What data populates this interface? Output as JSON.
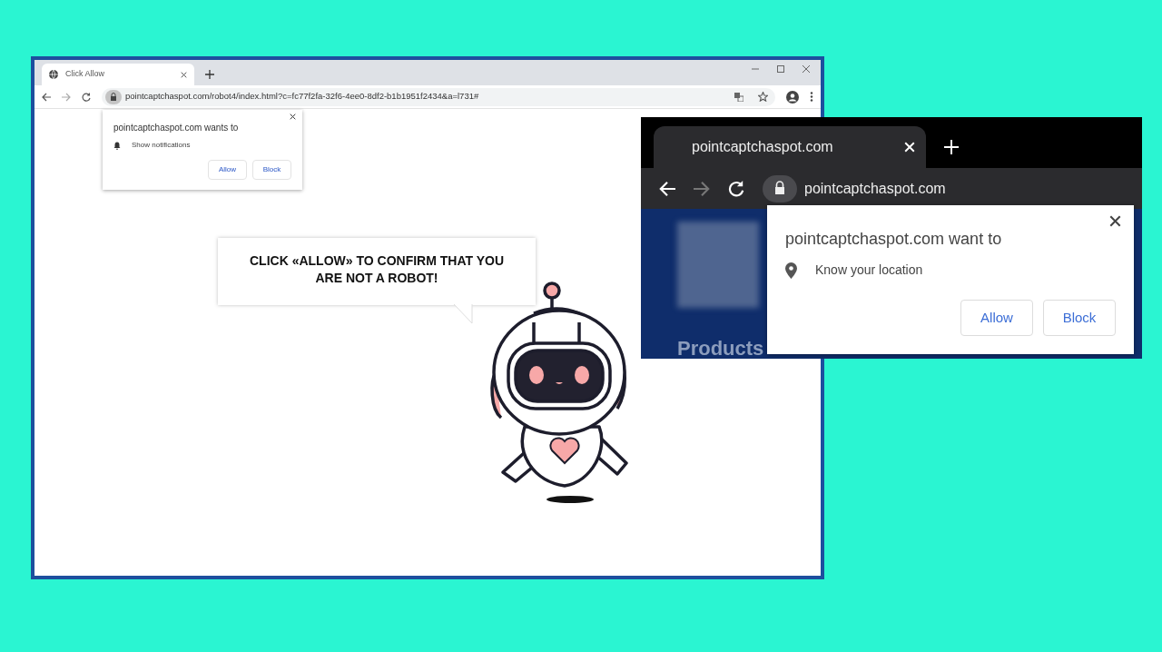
{
  "notification_window": {
    "tab": {
      "title": "Click Allow",
      "selected": true
    },
    "address": "pointcaptchaspot.com/robot4/index.html?c=fc77f2fa-32f6-4ee0-8df2-b1b1951f2434&a=l731#",
    "prompt": {
      "title": "pointcaptchaspot.com wants to",
      "permission": "Show notifications",
      "buttons": [
        "Allow",
        "Block"
      ]
    },
    "page": {
      "headline": "CLICK «ALLOW» TO CONFIRM THAT YOU ARE NOT A ROBOT!"
    }
  },
  "location_window": {
    "tab": {
      "title": "pointcaptchaspot.com",
      "selected": true
    },
    "address": "pointcaptchaspot.com",
    "prompt": {
      "title": "pointcaptchaspot.com want to",
      "permission": "Know your location",
      "buttons": [
        "Allow",
        "Block"
      ]
    },
    "page": {
      "nav_item": "Products"
    }
  }
}
